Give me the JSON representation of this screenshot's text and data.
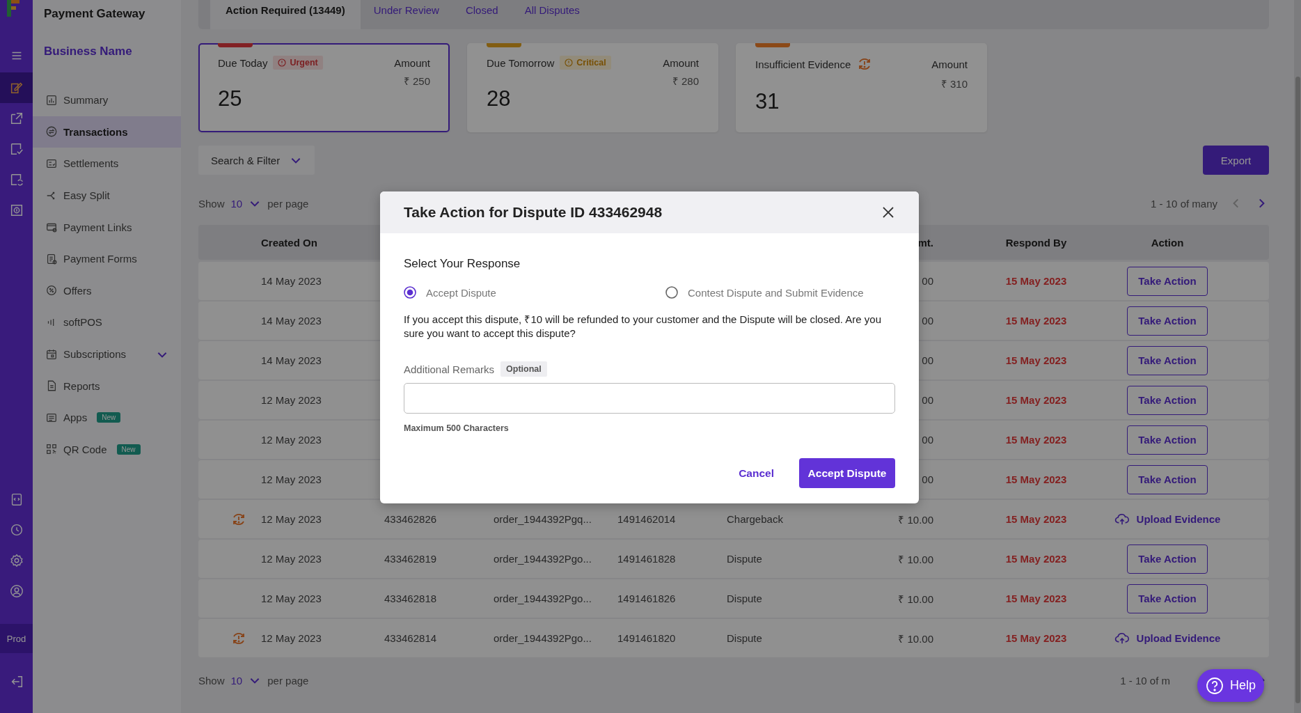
{
  "rail": {
    "items": [
      {
        "selected": true
      },
      {
        "selected": false
      },
      {
        "selected": false
      },
      {
        "selected": false
      },
      {
        "selected": false
      }
    ],
    "env": "Prod"
  },
  "sidebar": {
    "title": "Payment Gateway",
    "business": "Business Name",
    "items": [
      {
        "label": "Summary",
        "selected": false
      },
      {
        "label": "Transactions",
        "selected": true
      },
      {
        "label": "Settlements",
        "selected": false
      },
      {
        "label": "Easy Split",
        "selected": false
      },
      {
        "label": "Payment Links",
        "selected": false
      },
      {
        "label": "Payment Forms",
        "selected": false
      },
      {
        "label": "Offers",
        "selected": false
      },
      {
        "label": "softPOS",
        "selected": false
      },
      {
        "label": "Subscriptions",
        "selected": false,
        "expanded": false
      },
      {
        "label": "Reports",
        "selected": false
      },
      {
        "label": "Apps",
        "selected": false,
        "badge": "New"
      },
      {
        "label": "QR Code",
        "selected": false,
        "badge": "New"
      }
    ]
  },
  "tabs": [
    {
      "label": "Action Required (13449)",
      "selected": true
    },
    {
      "label": "Under Review",
      "selected": false
    },
    {
      "label": "Closed",
      "selected": false
    },
    {
      "label": "All Disputes",
      "selected": false
    }
  ],
  "cards": [
    {
      "kind": "urgent",
      "label": "Due Today",
      "badge": "Urgent",
      "amount_label": "Amount",
      "amount": "₹ 250",
      "count": "25",
      "selected": true
    },
    {
      "kind": "critical",
      "label": "Due Tomorrow",
      "badge": "Critical",
      "amount_label": "Amount",
      "amount": "₹ 280",
      "count": "28",
      "selected": false
    },
    {
      "kind": "evidence",
      "label": "Insufficient Evidence",
      "amount_label": "Amount",
      "amount": "₹ 310",
      "count": "31",
      "selected": false
    }
  ],
  "filter_button": "Search & Filter",
  "export_button": "Export",
  "page_size_top": {
    "label": "Show",
    "value": "10",
    "suffix": "per page"
  },
  "pager_top": {
    "range": "1 - 10 of many",
    "prev": {
      "disabled": true
    },
    "next": {
      "disabled": false
    }
  },
  "table": {
    "columns": [
      "Created On",
      "mt.",
      "Respond By",
      "Action"
    ],
    "rows": [
      {
        "warning": false,
        "date": "14 May 2023",
        "amount": "00",
        "respond_by": "15 May 2023",
        "kind": "take_action",
        "action": "Take Action"
      },
      {
        "warning": false,
        "date": "14 May 2023",
        "amount": "00",
        "respond_by": "15 May 2023",
        "kind": "take_action",
        "action": "Take Action"
      },
      {
        "warning": false,
        "date": "14 May 2023",
        "amount": "00",
        "respond_by": "15 May 2023",
        "kind": "take_action",
        "action": "Take Action"
      },
      {
        "warning": false,
        "date": "12 May 2023",
        "amount": "00",
        "respond_by": "15 May 2023",
        "kind": "take_action",
        "action": "Take Action"
      },
      {
        "warning": false,
        "date": "12 May 2023",
        "amount": "00",
        "respond_by": "15 May 2023",
        "kind": "take_action",
        "action": "Take Action"
      },
      {
        "warning": false,
        "date": "12 May 2023",
        "amount": "00",
        "respond_by": "15 May 2023",
        "kind": "take_action",
        "action": "Take Action"
      },
      {
        "warning": true,
        "date": "12 May 2023",
        "dispute_id": "433462826",
        "order_id": "order_1944392Pgq...",
        "txn_id": "1491462014",
        "type": "Chargeback",
        "amount": "₹ 10.00",
        "respond_by": "15 May 2023",
        "kind": "upload_evidence",
        "action": "Upload Evidence"
      },
      {
        "warning": false,
        "date": "12 May 2023",
        "dispute_id": "433462819",
        "order_id": "order_1944392Pgo...",
        "txn_id": "1491461828",
        "type": "Dispute",
        "amount": "₹ 10.00",
        "respond_by": "15 May 2023",
        "kind": "take_action",
        "action": "Take Action"
      },
      {
        "warning": false,
        "date": "12 May 2023",
        "dispute_id": "433462818",
        "order_id": "order_1944392Pgo...",
        "txn_id": "1491461826",
        "type": "Dispute",
        "amount": "₹ 10.00",
        "respond_by": "15 May 2023",
        "kind": "take_action",
        "action": "Take Action"
      },
      {
        "warning": true,
        "date": "12 May 2023",
        "dispute_id": "433462814",
        "order_id": "order_1944392Pgo...",
        "txn_id": "1491461820",
        "type": "Dispute",
        "amount": "₹ 10.00",
        "respond_by": "15 May 2023",
        "kind": "upload_evidence",
        "action": "Upload Evidence"
      }
    ]
  },
  "page_size_bottom": {
    "label": "Show",
    "value": "10",
    "suffix": "per page"
  },
  "pager_bottom": {
    "range": "1 - 10 of m"
  },
  "help_button": "Help",
  "modal": {
    "title": "Take Action for Dispute ID 433462948",
    "section": "Select Your Response",
    "options": [
      {
        "label": "Accept Dispute",
        "selected": true
      },
      {
        "label": "Contest Dispute and Submit Evidence",
        "selected": false
      }
    ],
    "message": "If you accept this dispute, ₹10 will be refunded to your customer and the Dispute will be closed. Are you sure you want to accept this dispute?",
    "remarks_label": "Additional Remarks",
    "remarks_tag": "Optional",
    "remarks_hint": "Maximum 500 Characters",
    "cancel": "Cancel",
    "confirm": "Accept Dispute"
  }
}
